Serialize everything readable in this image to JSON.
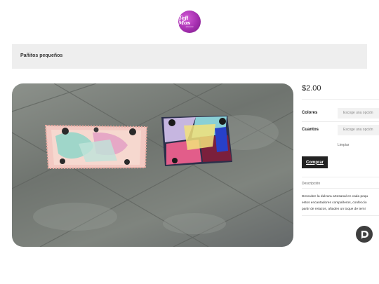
{
  "brand": {
    "logo_text": "Teji Mos",
    "logo_sub": "artesanal"
  },
  "product": {
    "title": "Pañitos pequeños",
    "price": "$2.00",
    "options": [
      {
        "label": "Colores",
        "placeholder": "Escoge una opción"
      },
      {
        "label": "Cuantos",
        "placeholder": "Escoge una opción"
      }
    ],
    "clear_label": "Limpiar",
    "buy_label": "Comprar",
    "description_label": "Descripción",
    "description_lines": [
      "Descubre la dulzura artesanal en cada pequ",
      "estos encantadores compañeros, confeccio",
      "partir de retazos, añaden un toque de terni"
    ]
  },
  "colors": {
    "logo": "#a52fb0",
    "button": "#222222",
    "title_bar": "#eeeeee"
  },
  "icons": {
    "chat": "chat-bubble-icon"
  }
}
